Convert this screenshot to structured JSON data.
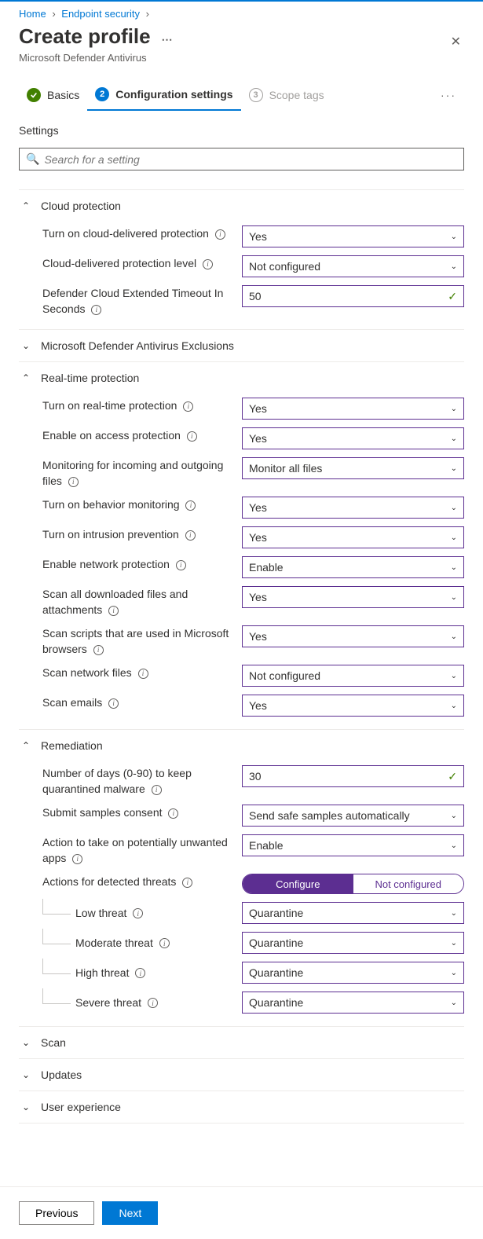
{
  "breadcrumb": {
    "home": "Home",
    "endpoint": "Endpoint security"
  },
  "header": {
    "title": "Create profile",
    "subtitle": "Microsoft Defender Antivirus"
  },
  "steps": {
    "s1": "Basics",
    "s2": "Configuration settings",
    "s3": "Scope tags",
    "n2": "2",
    "n3": "3"
  },
  "settingsLabel": "Settings",
  "search": {
    "placeholder": "Search for a setting"
  },
  "sections": {
    "cloud": {
      "title": "Cloud protection",
      "f1": {
        "label": "Turn on cloud-delivered protection",
        "value": "Yes"
      },
      "f2": {
        "label": "Cloud-delivered protection level",
        "value": "Not configured"
      },
      "f3": {
        "label": "Defender Cloud Extended Timeout In Seconds",
        "value": "50"
      }
    },
    "exclusions": {
      "title": "Microsoft Defender Antivirus Exclusions"
    },
    "realtime": {
      "title": "Real-time protection",
      "f1": {
        "label": "Turn on real-time protection",
        "value": "Yes"
      },
      "f2": {
        "label": "Enable on access protection",
        "value": "Yes"
      },
      "f3": {
        "label": "Monitoring for incoming and outgoing files",
        "value": "Monitor all files"
      },
      "f4": {
        "label": "Turn on behavior monitoring",
        "value": "Yes"
      },
      "f5": {
        "label": "Turn on intrusion prevention",
        "value": "Yes"
      },
      "f6": {
        "label": "Enable network protection",
        "value": "Enable"
      },
      "f7": {
        "label": "Scan all downloaded files and attachments",
        "value": "Yes"
      },
      "f8": {
        "label": "Scan scripts that are used in Microsoft browsers",
        "value": "Yes"
      },
      "f9": {
        "label": "Scan network files",
        "value": "Not configured"
      },
      "f10": {
        "label": "Scan emails",
        "value": "Yes"
      }
    },
    "remediation": {
      "title": "Remediation",
      "f1": {
        "label": "Number of days (0-90) to keep quarantined malware",
        "value": "30"
      },
      "f2": {
        "label": "Submit samples consent",
        "value": "Send safe samples automatically"
      },
      "f3": {
        "label": "Action to take on potentially unwanted apps",
        "value": "Enable"
      },
      "f4": {
        "label": "Actions for detected threats",
        "optA": "Configure",
        "optB": "Not configured"
      },
      "t1": {
        "label": "Low threat",
        "value": "Quarantine"
      },
      "t2": {
        "label": "Moderate threat",
        "value": "Quarantine"
      },
      "t3": {
        "label": "High threat",
        "value": "Quarantine"
      },
      "t4": {
        "label": "Severe threat",
        "value": "Quarantine"
      }
    },
    "scan": {
      "title": "Scan"
    },
    "updates": {
      "title": "Updates"
    },
    "ux": {
      "title": "User experience"
    }
  },
  "footer": {
    "prev": "Previous",
    "next": "Next"
  }
}
